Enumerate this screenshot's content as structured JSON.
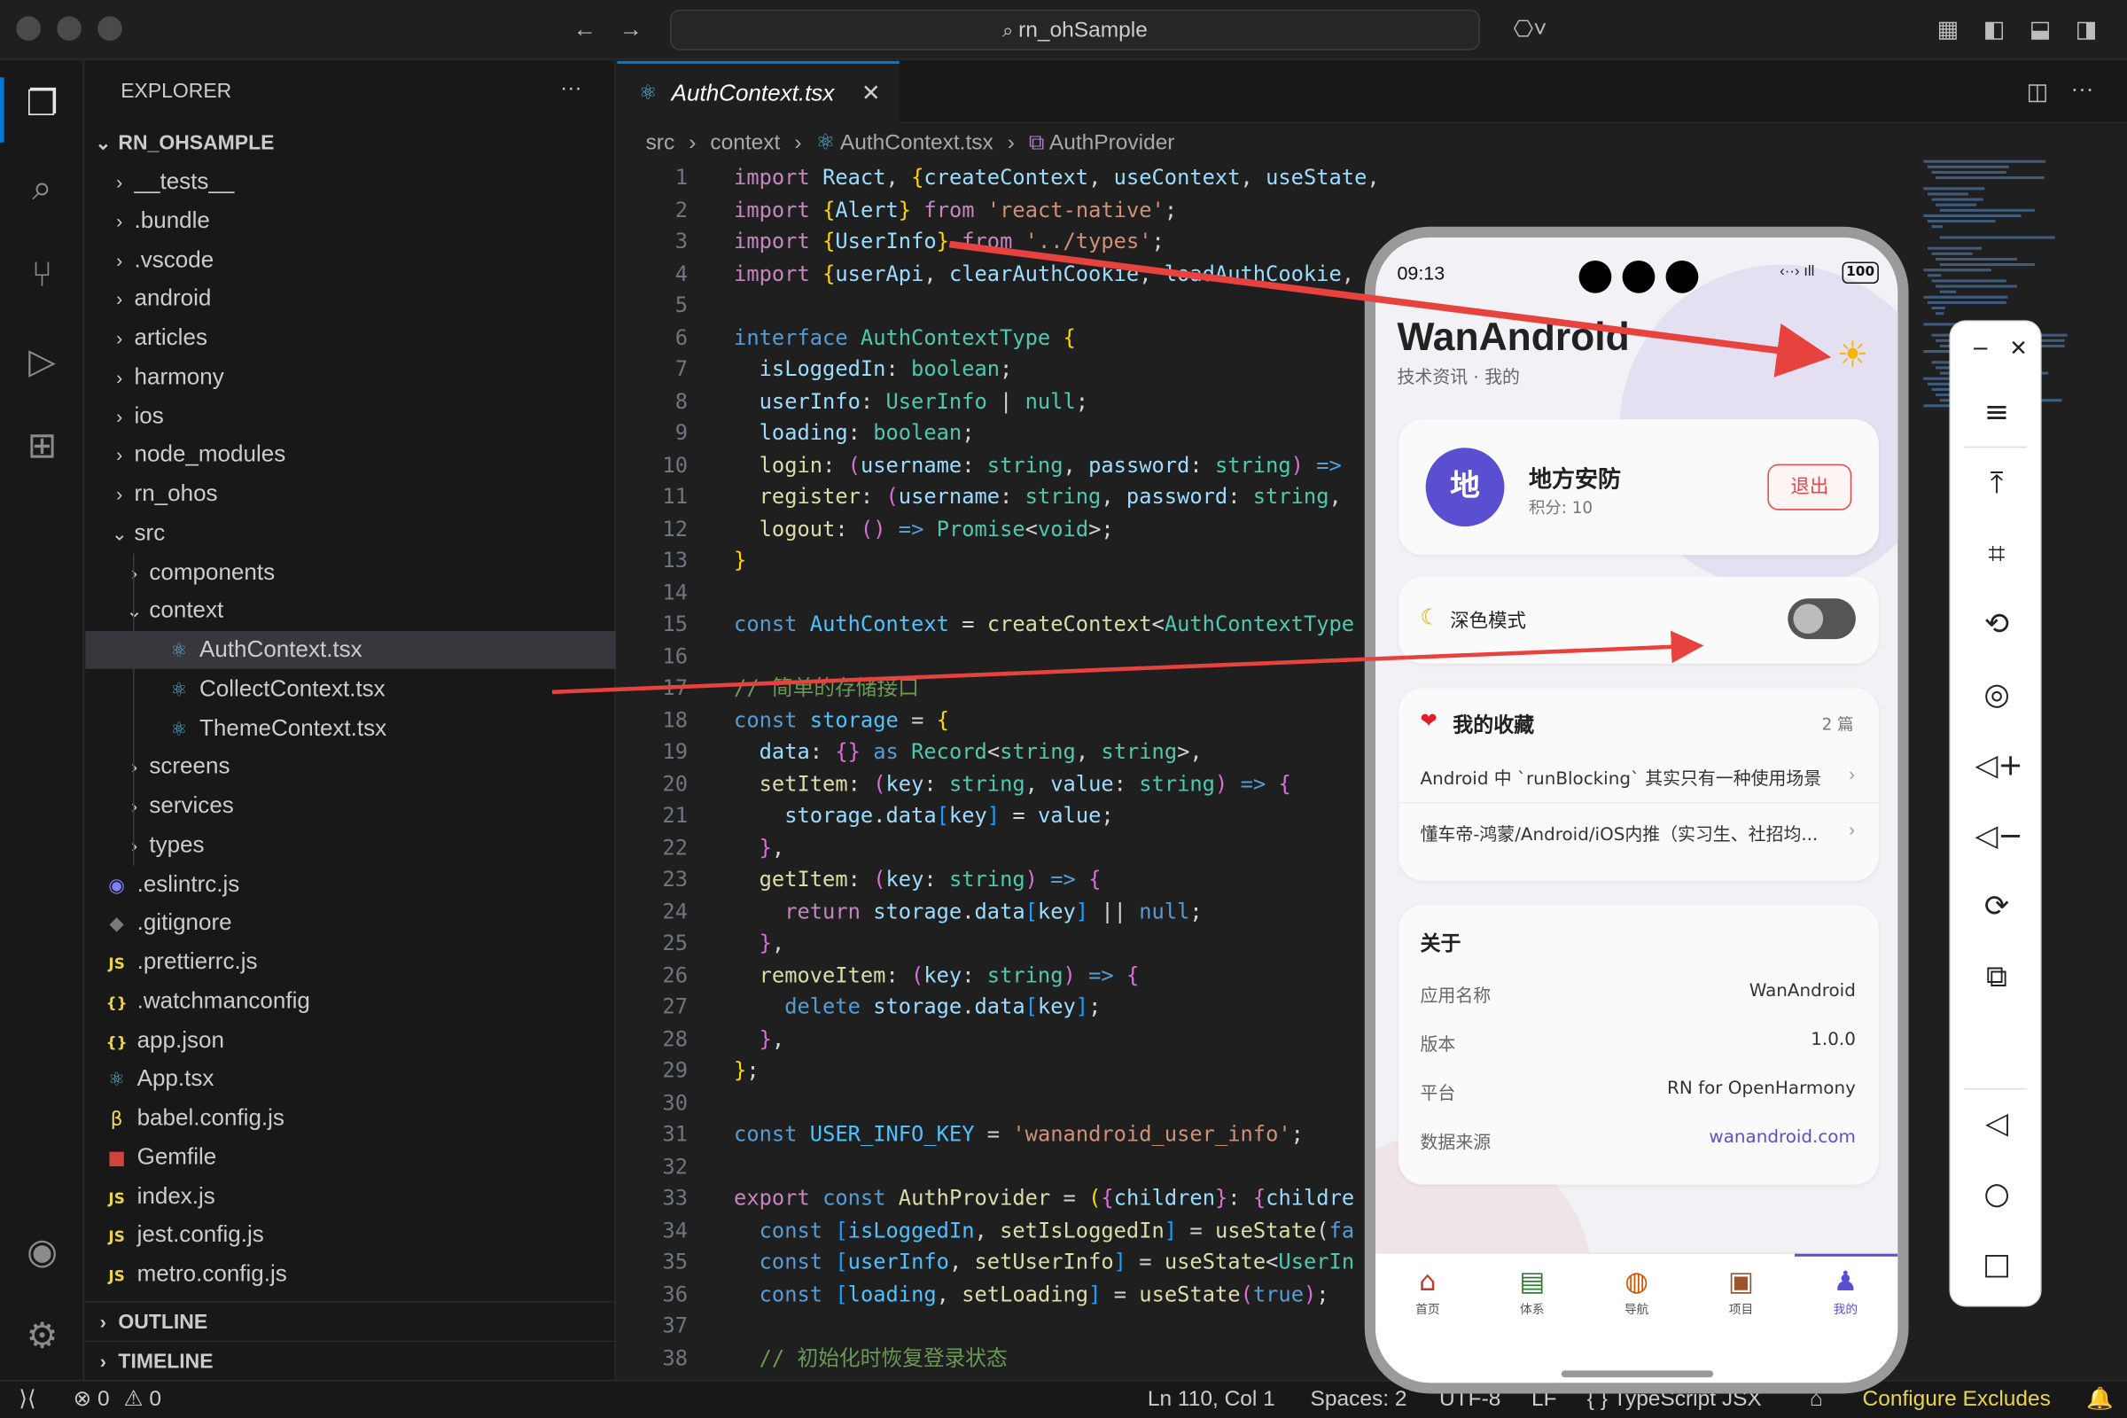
{
  "titlebar": {
    "search": "rn_ohSample"
  },
  "explorer": {
    "title": "EXPLORER",
    "more": "···",
    "root": "RN_OHSAMPLE",
    "items": [
      {
        "label": "__tests__",
        "kind": "folder",
        "depth": 1,
        "icon": "chevron-right"
      },
      {
        "label": ".bundle",
        "kind": "folder",
        "depth": 1,
        "icon": "chevron-right"
      },
      {
        "label": ".vscode",
        "kind": "folder",
        "depth": 1,
        "icon": "chevron-right"
      },
      {
        "label": "android",
        "kind": "folder",
        "depth": 1,
        "icon": "chevron-right"
      },
      {
        "label": "articles",
        "kind": "folder",
        "depth": 1,
        "icon": "chevron-right"
      },
      {
        "label": "harmony",
        "kind": "folder",
        "depth": 1,
        "icon": "chevron-right"
      },
      {
        "label": "ios",
        "kind": "folder",
        "depth": 1,
        "icon": "chevron-right"
      },
      {
        "label": "node_modules",
        "kind": "folder",
        "depth": 1,
        "icon": "chevron-right"
      },
      {
        "label": "rn_ohos",
        "kind": "folder",
        "depth": 1,
        "icon": "chevron-right"
      },
      {
        "label": "src",
        "kind": "folder-open",
        "depth": 1,
        "icon": "chevron-down"
      },
      {
        "label": "components",
        "kind": "folder",
        "depth": 2,
        "icon": "chevron-right"
      },
      {
        "label": "context",
        "kind": "folder-open",
        "depth": 2,
        "icon": "chevron-down"
      },
      {
        "label": "AuthContext.tsx",
        "kind": "react",
        "depth": 3,
        "icon": "react-icon",
        "selected": true
      },
      {
        "label": "CollectContext.tsx",
        "kind": "react",
        "depth": 3,
        "icon": "react-icon"
      },
      {
        "label": "ThemeContext.tsx",
        "kind": "react",
        "depth": 3,
        "icon": "react-icon"
      },
      {
        "label": "screens",
        "kind": "folder",
        "depth": 2,
        "icon": "chevron-right"
      },
      {
        "label": "services",
        "kind": "folder",
        "depth": 2,
        "icon": "chevron-right"
      },
      {
        "label": "types",
        "kind": "folder",
        "depth": 2,
        "icon": "chevron-right"
      },
      {
        "label": ".eslintrc.js",
        "kind": "eslint",
        "depth": 1,
        "icon": "eslint-icon"
      },
      {
        "label": ".gitignore",
        "kind": "git",
        "depth": 1,
        "icon": "git-icon"
      },
      {
        "label": ".prettierrc.js",
        "kind": "js",
        "depth": 1,
        "icon": "js-icon"
      },
      {
        "label": ".watchmanconfig",
        "kind": "json",
        "depth": 1,
        "icon": "json-icon"
      },
      {
        "label": "app.json",
        "kind": "json",
        "depth": 1,
        "icon": "json-icon"
      },
      {
        "label": "App.tsx",
        "kind": "react",
        "depth": 1,
        "icon": "react-icon"
      },
      {
        "label": "babel.config.js",
        "kind": "babel",
        "depth": 1,
        "icon": "babel-icon"
      },
      {
        "label": "Gemfile",
        "kind": "ruby",
        "depth": 1,
        "icon": "ruby-icon"
      },
      {
        "label": "index.js",
        "kind": "js",
        "depth": 1,
        "icon": "js-icon"
      },
      {
        "label": "jest.config.js",
        "kind": "js",
        "depth": 1,
        "icon": "js-icon"
      },
      {
        "label": "metro.config.js",
        "kind": "js",
        "depth": 1,
        "icon": "js-icon"
      }
    ],
    "outline": "OUTLINE",
    "timeline": "TIMELINE"
  },
  "editor": {
    "tab": "AuthContext.tsx",
    "breadcrumb": [
      "src",
      "context",
      "AuthContext.tsx",
      "AuthProvider"
    ],
    "line_numbers": [
      "1",
      "2",
      "3",
      "4",
      "5",
      "6",
      "7",
      "8",
      "9",
      "10",
      "11",
      "12",
      "13",
      "14",
      "15",
      "16",
      "17",
      "18",
      "19",
      "20",
      "21",
      "22",
      "23",
      "24",
      "25",
      "26",
      "27",
      "28",
      "29",
      "30",
      "31",
      "32",
      "33",
      "34",
      "35",
      "36",
      "37",
      "38"
    ]
  },
  "status": {
    "errors": "0",
    "warnings": "0",
    "position": "Ln 110, Col 1",
    "spaces": "Spaces: 2",
    "encoding": "UTF-8",
    "eol": "LF",
    "language": "TypeScript JSX",
    "configure": "Configure Excludes"
  },
  "phone": {
    "time": "09:13",
    "battery": "100",
    "app_title": "WanAndroid",
    "app_subtitle": "技术资讯 · 我的",
    "user": {
      "avatar": "地",
      "name": "地方安防",
      "points": "积分: 10",
      "logout": "退出"
    },
    "dark_mode": {
      "label": "深色模式",
      "enabled": false
    },
    "favorites": {
      "title": "我的收藏",
      "count": "2 篇",
      "items": [
        "Android 中 `runBlocking` 其实只有一种使用场景",
        "懂车帝-鸿蒙/Android/iOS内推（实习生、社招均..."
      ]
    },
    "about": {
      "title": "关于",
      "rows": [
        {
          "label": "应用名称",
          "value": "WanAndroid"
        },
        {
          "label": "版本",
          "value": "1.0.0"
        },
        {
          "label": "平台",
          "value": "RN for OpenHarmony"
        },
        {
          "label": "数据来源",
          "value": "wanandroid.com"
        }
      ]
    },
    "nav": [
      {
        "label": "首页",
        "icon": "house-icon"
      },
      {
        "label": "体系",
        "icon": "books-icon"
      },
      {
        "label": "导航",
        "icon": "compass-icon"
      },
      {
        "label": "项目",
        "icon": "package-icon"
      },
      {
        "label": "我的",
        "icon": "person-icon",
        "active": true
      }
    ],
    "accent": "#5b4fd1"
  },
  "colors": {
    "selection": "#37373d",
    "accent_blue": "#0078d4",
    "arrow": "#e8423f"
  }
}
